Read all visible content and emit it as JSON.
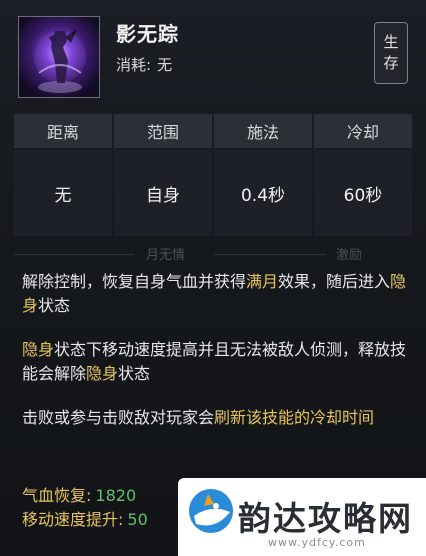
{
  "skill": {
    "name": "影无踪",
    "cost_label": "消耗:",
    "cost_value": "无",
    "badge": [
      "生",
      "存"
    ]
  },
  "stats": [
    {
      "label": "距离",
      "value": "无"
    },
    {
      "label": "范围",
      "value": "自身"
    },
    {
      "label": "施法",
      "value": "0.4秒"
    },
    {
      "label": "冷却",
      "value": "60秒"
    }
  ],
  "tabs": [
    "月无情",
    "激励"
  ],
  "description": {
    "p1": [
      "解除控制，恢复自身气血并获得",
      "满月",
      "效果，随后进入",
      "隐身",
      "状态"
    ],
    "p2": [
      "隐身",
      "状态下移动速度提高并且无法被敌人侦测，释放技能会解除",
      "隐身",
      "状态"
    ],
    "p3": [
      "击败或参与击败敌对玩家会",
      "刷新该技能的冷却时间"
    ]
  },
  "attributes": [
    {
      "label": "气血恢复:",
      "value": "1820"
    },
    {
      "label": "移动速度提升:",
      "value": "50"
    }
  ],
  "watermark": {
    "brand": "韵达攻略网",
    "url": "www.ydfcy.com",
    "top_text": "www.ydfcy.com"
  },
  "colors": {
    "highlight": "#e9c45a",
    "value_green": "#64c06a",
    "panel_bg": "#15181c",
    "icon_purple": "#7b3fd6"
  },
  "icons": {
    "skill": "shadow-figure-icon",
    "watermark_logo": "bird-logo-icon"
  }
}
